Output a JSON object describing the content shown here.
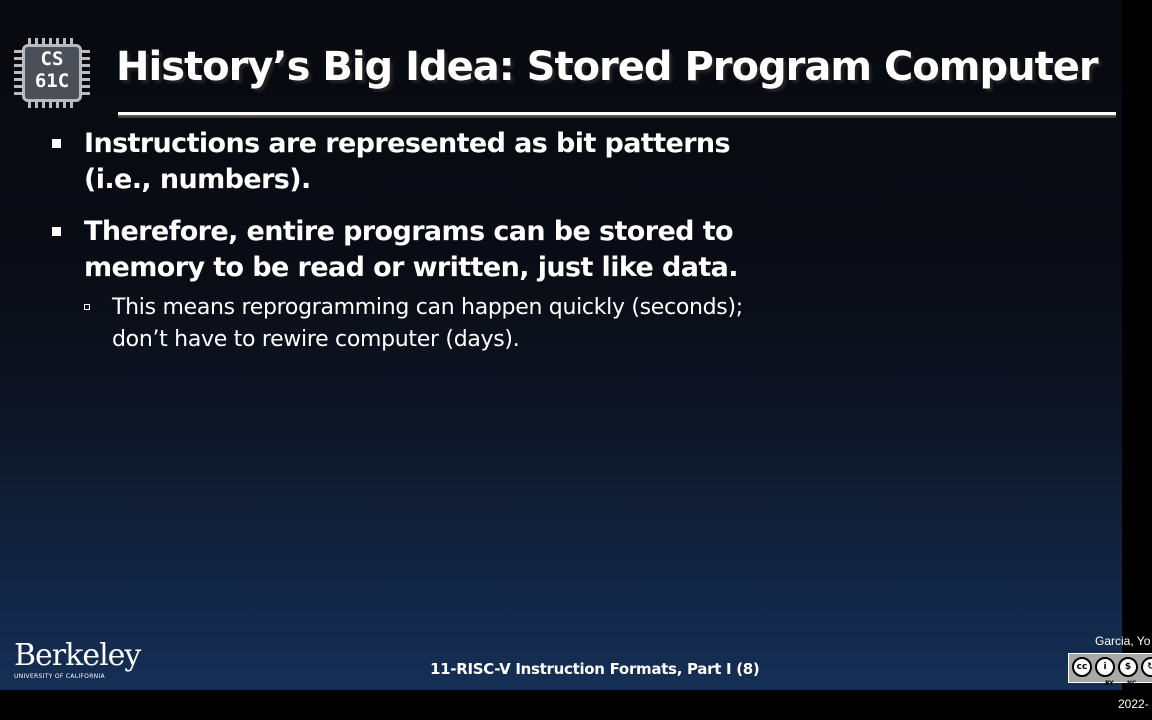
{
  "logo": {
    "line1": "CS",
    "line2": "61C"
  },
  "title": "History’s Big Idea: Stored Program Computer",
  "bullets": [
    {
      "lines": [
        "Instructions are represented as bit patterns",
        "(i.e., numbers)."
      ]
    },
    {
      "lines": [
        "Therefore, entire programs can be stored to",
        "memory to be read or written, just like data."
      ],
      "sub": [
        "This means reprogramming can happen quickly (seconds);",
        "don’t have to rewire computer (days)."
      ]
    }
  ],
  "berkeley": {
    "word": "Berkeley",
    "subtitle": "UNIVERSITY OF CALIFORNIA"
  },
  "footer": {
    "text": "11-RISC-V Instruction Formats, Part I (8)"
  },
  "author": "Garcia, Yo",
  "license": {
    "icons": [
      "cc-icon",
      "by-icon",
      "nc-icon",
      "sa-icon"
    ],
    "labels": [
      "BY",
      "NC"
    ]
  },
  "year": "2022-"
}
